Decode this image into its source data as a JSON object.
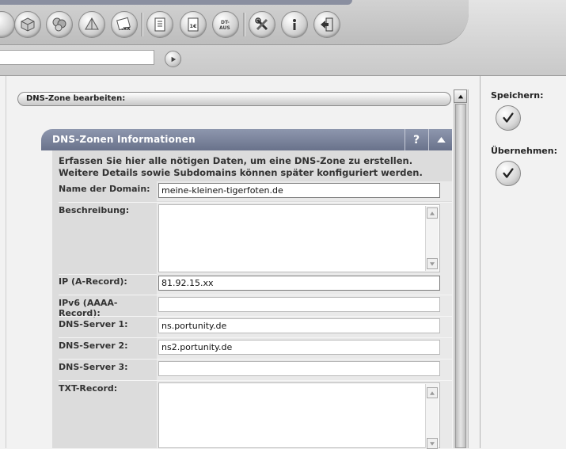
{
  "toolbar": {
    "icons": [
      "cube-icon",
      "cubes-icon",
      "pyramid-icon",
      "xx-domain-icon",
      "document-icon",
      "invoice-euro-icon",
      "dt-aus-icon",
      "tools-icon",
      "info-icon",
      "exit-icon"
    ],
    "euro_label": "1€",
    "dt_label_1": "DT-",
    "dt_label_2": "AUS",
    "search_value": ""
  },
  "section": {
    "title": "DNS-Zone bearbeiten:"
  },
  "panel": {
    "title": "DNS-Zonen Informationen",
    "help_label": "?",
    "intro": "Erfassen Sie hier alle nötigen Daten, um eine DNS-Zone zu erstellen. Weitere Details sowie Subdomains können später konfiguriert werden."
  },
  "form": {
    "domain": {
      "label": "Name der Domain:",
      "value": "meine-kleinen-tigerfoten.de"
    },
    "description": {
      "label": "Beschreibung:",
      "value": ""
    },
    "ipv4": {
      "label": "IP (A-Record):",
      "value": "81.92.15.xx"
    },
    "ipv6": {
      "label": "IPv6 (AAAA-Record):",
      "value": ""
    },
    "dns1": {
      "label": "DNS-Server 1:",
      "value": "ns.portunity.de"
    },
    "dns2": {
      "label": "DNS-Server 2:",
      "value": "ns2.portunity.de"
    },
    "dns3": {
      "label": "DNS-Server 3:",
      "value": ""
    },
    "txt": {
      "label": "TXT-Record:",
      "value": ""
    }
  },
  "sidebar": {
    "save_label": "Speichern:",
    "apply_label": "Übernehmen:"
  },
  "colors": {
    "panel_header": "#7c849b",
    "background": "#f2f2f2"
  }
}
